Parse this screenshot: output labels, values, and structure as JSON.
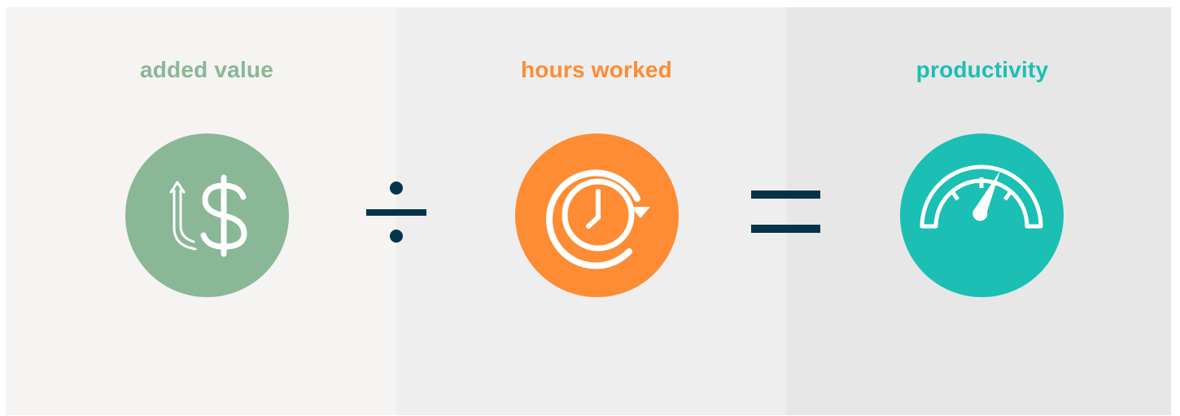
{
  "colors": {
    "panel_1_bg": "#f5f4f2",
    "panel_2_bg": "#eeeeee",
    "panel_3_bg": "#e7e7e7",
    "added_value": "#8ab795",
    "hours_worked": "#fd8c34",
    "productivity": "#1bbfb4",
    "operator": "#05344a"
  },
  "steps": [
    {
      "label": "added value",
      "icon": "dollar-up-arrow-icon"
    },
    {
      "label": "hours worked",
      "icon": "clock-rotate-icon"
    },
    {
      "label": "productivity",
      "icon": "speedometer-icon"
    }
  ],
  "operators": [
    "divide-icon",
    "equals-icon"
  ]
}
